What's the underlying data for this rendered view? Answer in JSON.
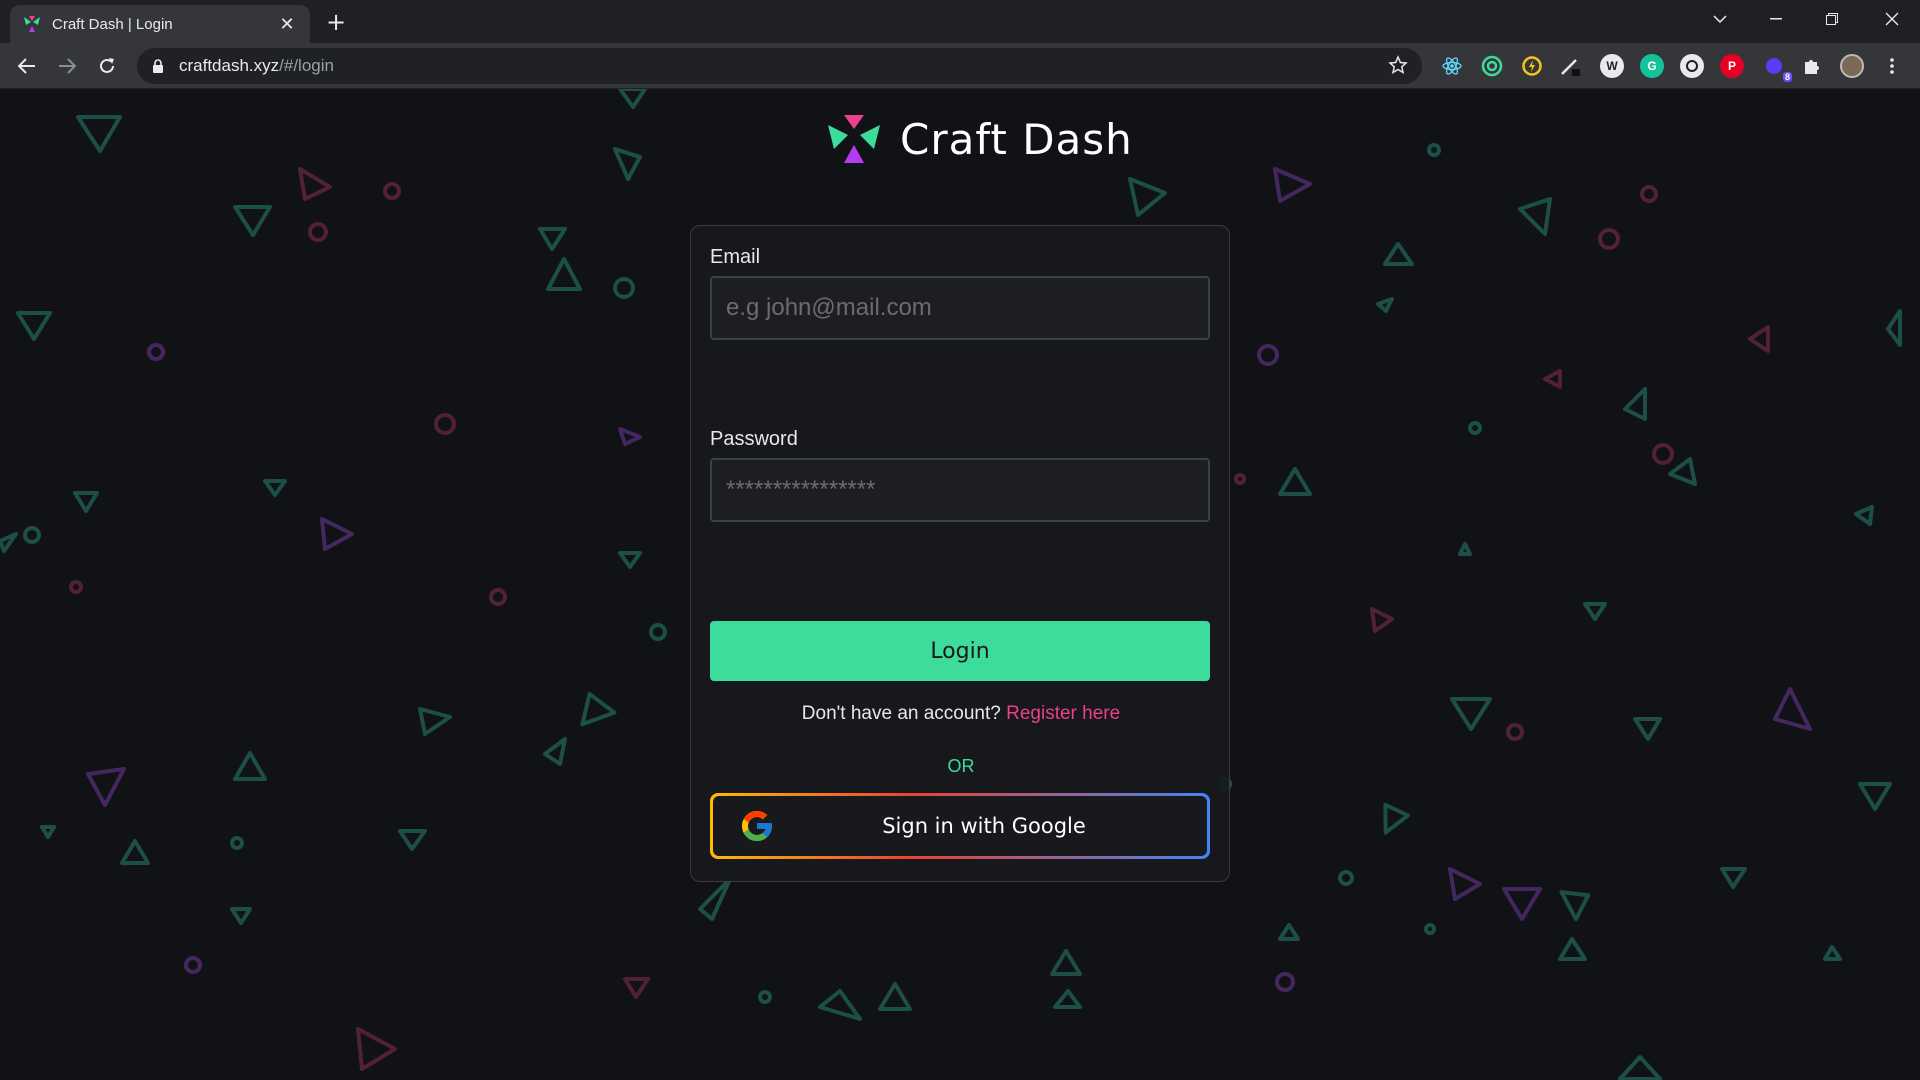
{
  "browser": {
    "tab_title": "Craft Dash | Login",
    "tab_close": "✕",
    "new_tab": "+",
    "url_host": "craftdash.xyz",
    "url_path": "/#/login",
    "extension_badge": "8"
  },
  "brand": {
    "name": "Craft Dash"
  },
  "login_form": {
    "email_label": "Email",
    "email_placeholder": "e.g john@mail.com",
    "password_label": "Password",
    "password_placeholder": "****************",
    "login_button": "Login",
    "register_prompt": "Don't have an account?",
    "register_link": "Register here",
    "or_divider": "OR",
    "google_button": "Sign in with Google"
  },
  "colors": {
    "accent_green": "#3ddc9a",
    "accent_pink": "#ec3f8c",
    "background": "#111216"
  }
}
